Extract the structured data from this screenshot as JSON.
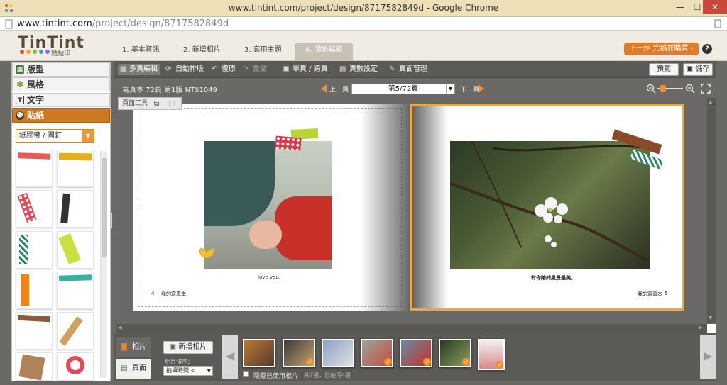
{
  "window": {
    "title": "www.tintint.com/project/design/8717582849d - Google Chrome",
    "url_host": "www.tintint.com",
    "url_path": "/project/design/8717582849d"
  },
  "brand": {
    "logo": "TinTint",
    "sub": "點點印"
  },
  "steps": [
    {
      "label": "1. 基本資訊"
    },
    {
      "label": "2. 新增相片"
    },
    {
      "label": "3. 套用主題"
    },
    {
      "label": "4. 開始編輯"
    }
  ],
  "next_button": "下一步 完稿並購買",
  "help": "?",
  "left_panel": {
    "categories": [
      {
        "label": "版型"
      },
      {
        "label": "風格"
      },
      {
        "label": "文字"
      },
      {
        "label": "貼紙"
      }
    ],
    "dropdown_value": "紙膠帶 / 圖釘"
  },
  "toolbar": {
    "multi_edit": "多頁編輯",
    "auto_layout": "自動排版",
    "undo": "復原",
    "redo": "重做",
    "single_spread": "單頁 / 跨頁",
    "page_settings": "頁數設定",
    "page_manage": "頁面管理",
    "preview": "預覽",
    "save": "儲存"
  },
  "info": {
    "summary": "寫真本 72頁 第1版 NT$1049",
    "prev": "上一頁",
    "next": "下一頁",
    "page_select": "第5/72頁"
  },
  "page_tools_label": "頁面工具",
  "spread": {
    "left_caption": "love you.",
    "left_page_number": "4",
    "left_footer": "我的寫真本",
    "right_caption": "有你陪的風景最美。",
    "right_footer": "我的寫真本",
    "right_page_number": "5"
  },
  "bottom": {
    "tab_photos": "相片",
    "tab_pages": "頁面",
    "add_photo": "新增相片",
    "sort_label": "相片排序：",
    "sort_value": "拍攝時間 <",
    "hide_used": "隱藏已使用相片",
    "count_text": "共7張，已使用4張"
  },
  "colors": {
    "accent": "#e07b2a",
    "selection": "#f0a83a"
  }
}
